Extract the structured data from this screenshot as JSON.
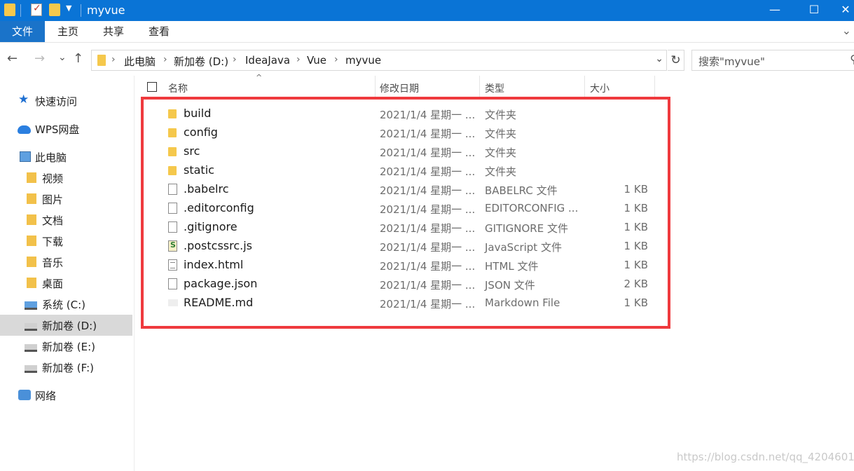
{
  "window": {
    "title": "myvue",
    "min_glyph": "—",
    "max_glyph": "☐",
    "close_glyph": "✕"
  },
  "ribbon": {
    "tabs": [
      "文件",
      "主页",
      "共享",
      "查看"
    ],
    "expand_glyph": "⌄"
  },
  "nav": {
    "back_glyph": "←",
    "forward_glyph": "→",
    "recent_glyph": "⌄",
    "up_glyph": "↑",
    "breadcrumbs": [
      "此电脑",
      "新加卷 (D:)",
      "IdeaJava",
      "Vue",
      "myvue"
    ],
    "crumb_separator": "›",
    "dropdown_glyph": "⌄",
    "refresh_glyph": "↻"
  },
  "search": {
    "placeholder": "搜索\"myvue\"",
    "icon_glyph": "⚲"
  },
  "sidebar": {
    "items": [
      {
        "label": "快速访问",
        "icon": "star-icon"
      },
      {
        "label": "WPS网盘",
        "icon": "cloud-icon"
      },
      {
        "label": "此电脑",
        "icon": "computer-icon"
      },
      {
        "label": "视频",
        "icon": "video-library-icon"
      },
      {
        "label": "图片",
        "icon": "pictures-library-icon"
      },
      {
        "label": "文档",
        "icon": "documents-library-icon"
      },
      {
        "label": "下载",
        "icon": "downloads-library-icon"
      },
      {
        "label": "音乐",
        "icon": "music-library-icon"
      },
      {
        "label": "桌面",
        "icon": "desktop-library-icon"
      },
      {
        "label": "系统 (C:)",
        "icon": "system-drive-icon"
      },
      {
        "label": "新加卷 (D:)",
        "icon": "drive-icon",
        "selected": true
      },
      {
        "label": "新加卷 (E:)",
        "icon": "drive-icon"
      },
      {
        "label": "新加卷 (F:)",
        "icon": "drive-icon"
      },
      {
        "label": "网络",
        "icon": "network-icon"
      }
    ],
    "star_glyph": "★"
  },
  "columns": {
    "name": "名称",
    "date": "修改日期",
    "type": "类型",
    "size": "大小",
    "sort_glyph": "^"
  },
  "files": [
    {
      "name": "build",
      "date": "2021/1/4 星期一 ...",
      "type": "文件夹",
      "size": "",
      "icon": "folder-icon"
    },
    {
      "name": "config",
      "date": "2021/1/4 星期一 ...",
      "type": "文件夹",
      "size": "",
      "icon": "folder-icon"
    },
    {
      "name": "src",
      "date": "2021/1/4 星期一 ...",
      "type": "文件夹",
      "size": "",
      "icon": "folder-icon"
    },
    {
      "name": "static",
      "date": "2021/1/4 星期一 ...",
      "type": "文件夹",
      "size": "",
      "icon": "folder-icon"
    },
    {
      "name": ".babelrc",
      "date": "2021/1/4 星期一 ...",
      "type": "BABELRC 文件",
      "size": "1 KB",
      "icon": "file-icon"
    },
    {
      "name": ".editorconfig",
      "date": "2021/1/4 星期一 ...",
      "type": "EDITORCONFIG ...",
      "size": "1 KB",
      "icon": "file-icon"
    },
    {
      "name": ".gitignore",
      "date": "2021/1/4 星期一 ...",
      "type": "GITIGNORE 文件",
      "size": "1 KB",
      "icon": "file-icon"
    },
    {
      "name": ".postcssrc.js",
      "date": "2021/1/4 星期一 ...",
      "type": "JavaScript 文件",
      "size": "1 KB",
      "icon": "js-file-icon"
    },
    {
      "name": "index.html",
      "date": "2021/1/4 星期一 ...",
      "type": "HTML 文件",
      "size": "1 KB",
      "icon": "html-file-icon"
    },
    {
      "name": "package.json",
      "date": "2021/1/4 星期一 ...",
      "type": "JSON 文件",
      "size": "2 KB",
      "icon": "file-icon"
    },
    {
      "name": "README.md",
      "date": "2021/1/4 星期一 ...",
      "type": "Markdown File",
      "size": "1 KB",
      "icon": "markdown-file-icon"
    }
  ],
  "watermark": "https://blog.csdn.net/qq_42046017",
  "colors": {
    "titlebar": "#0a74d6",
    "file_tab": "#1a73c9",
    "highlight_border": "#ef3a3e",
    "selection": "#d9d9d9"
  }
}
